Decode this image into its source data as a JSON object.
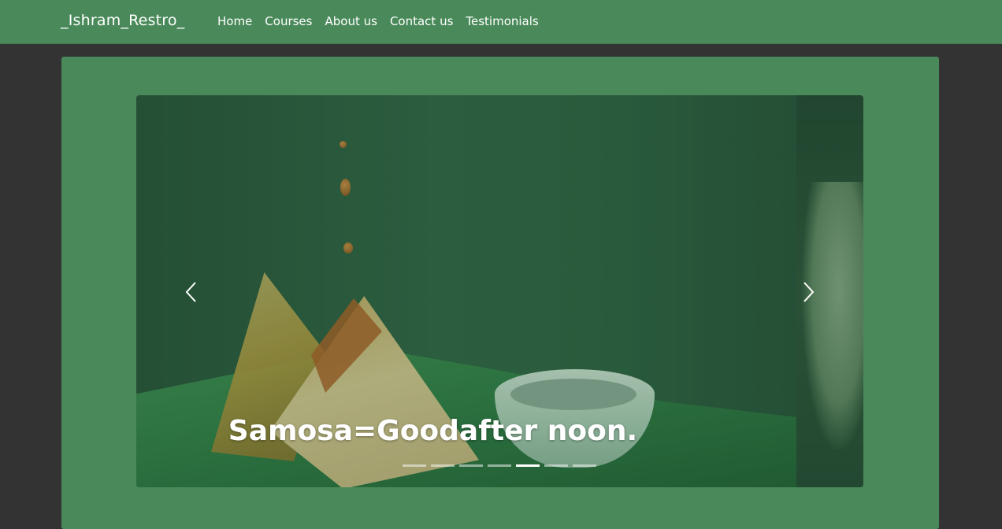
{
  "navbar": {
    "brand": "_Ishram_Restro_",
    "links": [
      {
        "label": "Home"
      },
      {
        "label": "Courses"
      },
      {
        "label": "About us"
      },
      {
        "label": "Contact us"
      },
      {
        "label": "Testimonials"
      }
    ]
  },
  "carousel": {
    "caption": "Samosa=Goodafter noon.",
    "indicator_count": 7,
    "active_indicator": 5,
    "prev_icon": "chevron-left-icon",
    "next_icon": "chevron-right-icon"
  },
  "colors": {
    "navbar_bg": "#4a8a5a",
    "page_bg": "#333333",
    "card_bg": "#4a8a5a",
    "text": "#ffffff"
  }
}
